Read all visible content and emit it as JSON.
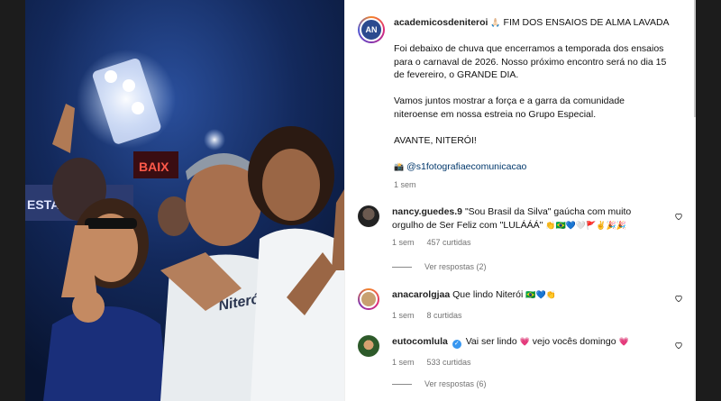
{
  "post": {
    "username": "academicosdeniteroi",
    "title_emoji": "🙏🏻",
    "title": "FIM DOS ENSAIOS DE ALMA LAVADA",
    "caption_lines": [
      "Foi debaixo de chuva que encerramos a temporada dos ensaios",
      "para o carnaval de 2026. Nosso próximo encontro será no dia 15",
      "de fevereiro, o GRANDE DIA."
    ],
    "caption_lines_2": [
      "Vamos juntos mostrar a força e a garra da comunidade",
      "niteroense em nossa estreia no Grupo Especial."
    ],
    "caption_line_3": "AVANTE, NITERÓI!",
    "credit_emoji": "📸",
    "credit_mention": "@s1fotografiaecomunicacao",
    "time": "1 sem"
  },
  "comments": [
    {
      "username": "nancy.guedes.9",
      "text_line1": "\"Sou Brasil da Silva\" gaúcha com muito",
      "text_line2": "orgulho de Ser Feliz com \"LULÁÁÁ\"",
      "emojis": "👏🇧🇷💙🤍🚩✌️🎉🎉",
      "time": "1 sem",
      "likes": "457 curtidas",
      "replies": "Ver respostas (2)"
    },
    {
      "username": "anacarolgjaa",
      "text": "Que lindo Niterói",
      "emojis": "🇧🇷💙👏",
      "time": "1 sem",
      "likes": "8 curtidas"
    },
    {
      "username": "eutocomlula",
      "verified_mark": "✓",
      "text_a": "Vai ser lindo",
      "emoji_a": "💗",
      "text_b": "vejo vocês domingo",
      "emoji_b": "💗",
      "time": "1 sem",
      "likes": "533 curtidas",
      "replies": "Ver respostas (6)"
    }
  ],
  "photo": {
    "description_free_text": "",
    "banner_text": "BAIX",
    "sign_text": "ESTA"
  },
  "colors": {
    "panel_bg": "#ffffff",
    "text": "#111111",
    "muted": "#737373",
    "link": "#00376b",
    "verified": "#3897f0"
  }
}
